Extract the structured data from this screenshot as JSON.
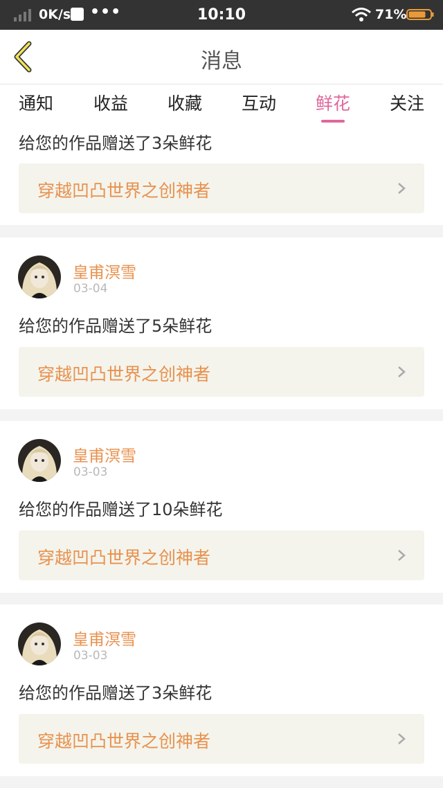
{
  "status_bar": {
    "network_speed": "0K/s",
    "more_indicator": "•••",
    "time": "10:10",
    "battery_percent": "71%"
  },
  "header": {
    "title": "消息"
  },
  "tabs": [
    {
      "label": "通知",
      "active": false
    },
    {
      "label": "收益",
      "active": false
    },
    {
      "label": "收藏",
      "active": false
    },
    {
      "label": "互动",
      "active": false
    },
    {
      "label": "鲜花",
      "active": true
    },
    {
      "label": "关注",
      "active": false
    }
  ],
  "colors": {
    "accent_pink": "#e0679c",
    "username_orange": "#e8914e",
    "status_bar": "#333333"
  },
  "feed": {
    "partial_item": {
      "message": "给您的作品赠送了3朵鲜花",
      "work_title": "穿越凹凸世界之创神者"
    },
    "items": [
      {
        "user": "皇甫溟雪",
        "date": "03-04",
        "message": "给您的作品赠送了5朵鲜花",
        "work_title": "穿越凹凸世界之创神者"
      },
      {
        "user": "皇甫溟雪",
        "date": "03-03",
        "message": "给您的作品赠送了10朵鲜花",
        "work_title": "穿越凹凸世界之创神者"
      },
      {
        "user": "皇甫溟雪",
        "date": "03-03",
        "message": "给您的作品赠送了3朵鲜花",
        "work_title": "穿越凹凸世界之创神者"
      }
    ]
  }
}
